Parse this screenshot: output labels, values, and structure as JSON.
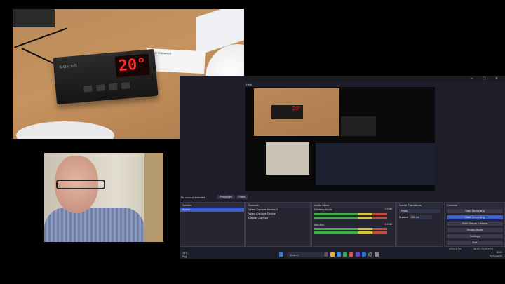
{
  "camera_feed_1": {
    "brand_label": "NOVUS",
    "display_value": "20°",
    "card_text": "Novus Instrument"
  },
  "obs": {
    "menu_label": "Help",
    "window_controls": "– ▢ ✕",
    "status_text": "No source selected",
    "properties_label": "Properties",
    "filters_label": "Filters",
    "scenes": {
      "title": "Scenes",
      "items": [
        "Scene"
      ]
    },
    "sources": {
      "title": "Sources",
      "items": [
        "Video Capture Device 2",
        "Video Capture Device",
        "Display Capture"
      ]
    },
    "audio_mixer": {
      "title": "Audio Mixer",
      "channels": [
        {
          "name": "Desktop Audio",
          "db": "0.0 dB"
        },
        {
          "name": "Mic/Aux",
          "db": "0.0 dB"
        }
      ]
    },
    "scene_transitions": {
      "title": "Scene Transitions",
      "transition": "Fade",
      "duration_label": "Duration",
      "duration_value": "300 ms"
    },
    "controls": {
      "title": "Controls",
      "buttons": [
        "Start Streaming",
        "Start Recording",
        "Start Virtual Camera",
        "Studio Mode",
        "Settings",
        "Exit"
      ]
    },
    "status_bar": {
      "cpu": "CPU: 4.7%",
      "fps": "30.00 / 30.00 FPS"
    }
  },
  "taskbar": {
    "weather_temp": "18°C",
    "weather_text": "Fog",
    "search_placeholder": "Search",
    "time": "10:21",
    "date": "12/07/2024"
  }
}
